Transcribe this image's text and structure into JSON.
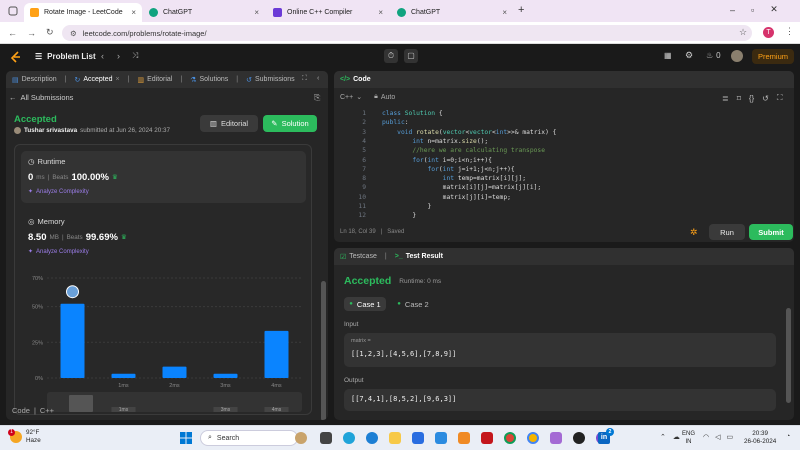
{
  "browser": {
    "tabs": [
      {
        "title": "Rotate Image - LeetCode",
        "active": true
      },
      {
        "title": "ChatGPT",
        "active": false
      },
      {
        "title": "Online C++ Compiler",
        "active": false
      },
      {
        "title": "ChatGPT",
        "active": false
      }
    ],
    "url": "leetcode.com/problems/rotate-image/",
    "profile_initial": "T"
  },
  "nav": {
    "problem_list": "Problem List",
    "streak": "0",
    "premium": "Premium"
  },
  "left": {
    "tabs": [
      "Description",
      "Accepted",
      "Editorial",
      "Solutions",
      "Submissions"
    ],
    "all_submissions": "All Submissions",
    "status": "Accepted",
    "user": "Tushar srivastava",
    "submitted_text": "submitted at Jun 26, 2024 20:37",
    "editorial_btn": "Editorial",
    "solution_btn": "Solution",
    "runtime": {
      "title": "Runtime",
      "value": "0",
      "unit": "ms",
      "beats_label": "Beats",
      "beats": "100.00%",
      "analyze": "Analyze Complexity"
    },
    "memory": {
      "title": "Memory",
      "value": "8.50",
      "unit": "MB",
      "beats_label": "Beats",
      "beats": "99.69%",
      "analyze": "Analyze Complexity"
    },
    "footer_code": "Code",
    "footer_lang": "C++"
  },
  "chart_data": {
    "type": "bar",
    "categories": [
      "",
      "1ms",
      "2ms",
      "3ms",
      "4ms"
    ],
    "values": [
      52,
      3,
      8,
      3,
      33
    ],
    "yticks": [
      "70%",
      "50%",
      "25%",
      "0%"
    ],
    "ylim": [
      0,
      70
    ],
    "mini_labels": [
      "",
      "1ms",
      "",
      "3ms",
      "4ms"
    ]
  },
  "editor": {
    "title": "Code",
    "lang": "C++",
    "mode": "Auto",
    "status": "Ln 18, Col 39",
    "saved": "Saved",
    "run": "Run",
    "submit": "Submit",
    "lines": [
      {
        "n": "1",
        "t": "class Solution {"
      },
      {
        "n": "2",
        "t": "public:"
      },
      {
        "n": "3",
        "t": "    void rotate(vector<vector<int>>& matrix) {"
      },
      {
        "n": "4",
        "t": "        int n=matrix.size();"
      },
      {
        "n": "5",
        "t": "        //here we are calculating transpose"
      },
      {
        "n": "6",
        "t": "        for(int i=0;i<n;i++){"
      },
      {
        "n": "7",
        "t": "            for(int j=i+1;j<n;j++){"
      },
      {
        "n": "8",
        "t": "                int temp=matrix[i][j];"
      },
      {
        "n": "9",
        "t": "                matrix[i][j]=matrix[j][i];"
      },
      {
        "n": "10",
        "t": "                matrix[j][i]=temp;"
      },
      {
        "n": "11",
        "t": "            }"
      },
      {
        "n": "12",
        "t": "        }"
      }
    ]
  },
  "result": {
    "testcase_tab": "Testcase",
    "result_tab": "Test Result",
    "status": "Accepted",
    "runtime": "Runtime: 0 ms",
    "case1": "Case 1",
    "case2": "Case 2",
    "input_label": "Input",
    "var_label": "matrix =",
    "input_value": "[[1,2,3],[4,5,6],[7,8,9]]",
    "output_label": "Output",
    "output_value": "[[7,4,1],[8,5,2],[9,6,3]]"
  },
  "taskbar": {
    "weather_badge": "1",
    "temp": "92°F",
    "condition": "Haze",
    "search": "Search",
    "lang1": "ENG",
    "lang2": "IN",
    "time": "20:39",
    "date": "26-06-2024",
    "badge2": "2"
  },
  "colors": {
    "green": "#2cbb5d",
    "blue": "#0a84ff",
    "accent_orange": "#ffa116"
  }
}
